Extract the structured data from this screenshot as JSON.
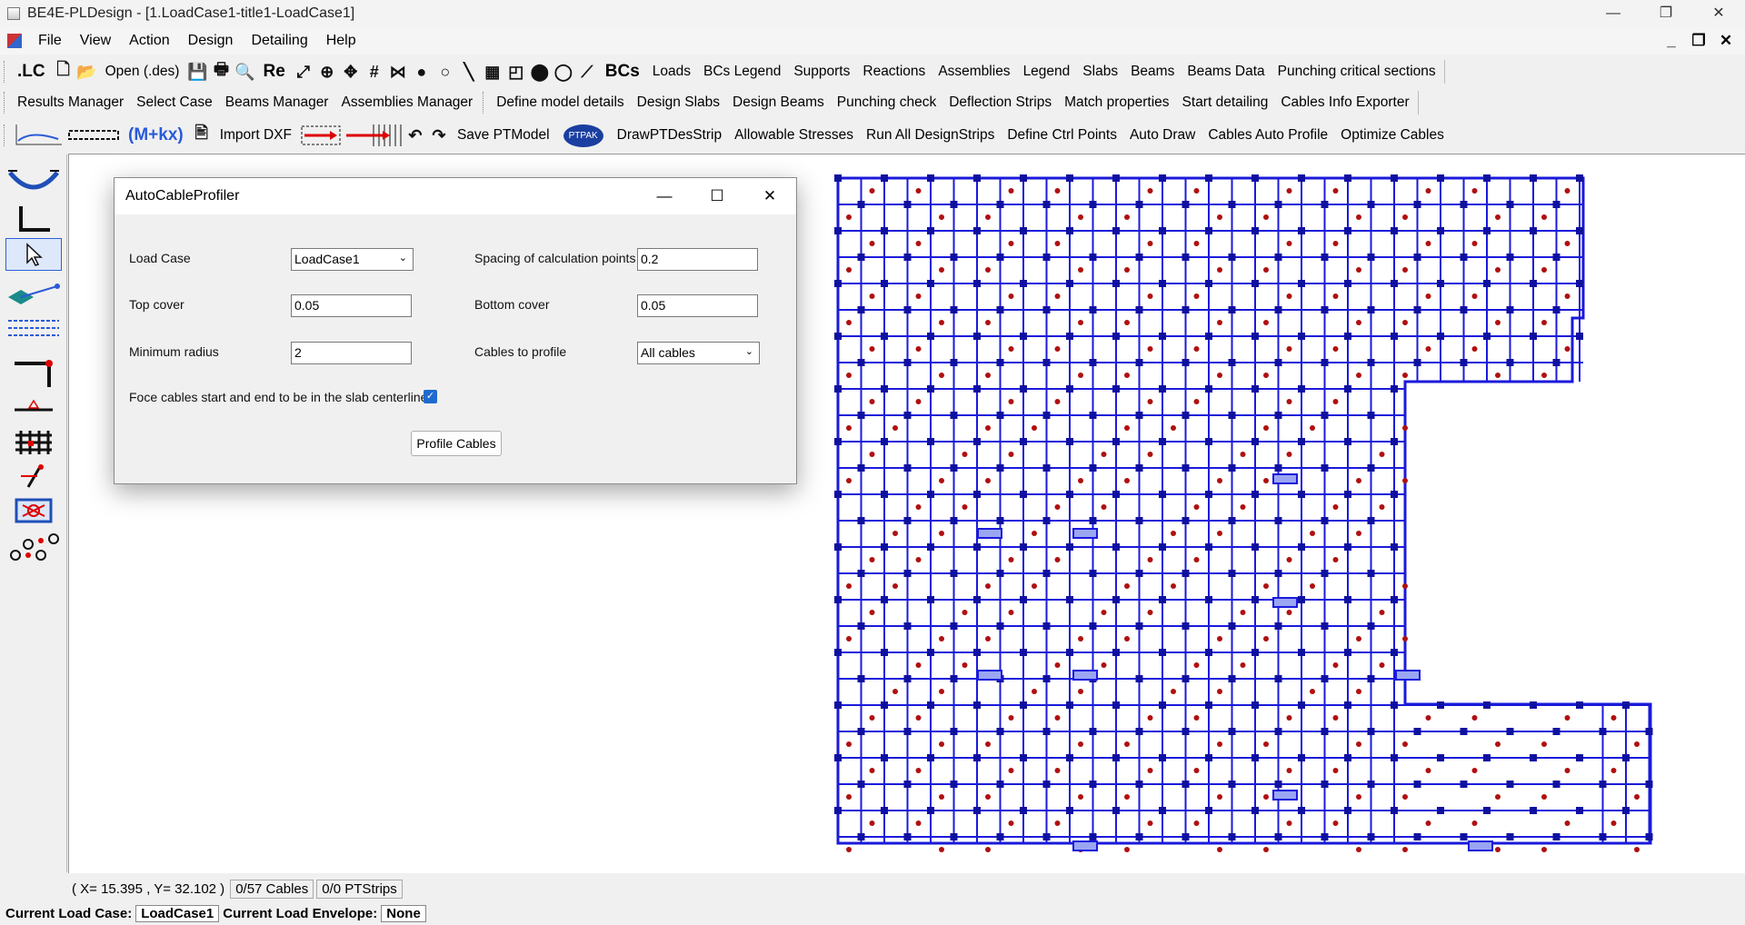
{
  "window": {
    "title": "BE4E-PLDesign - [1.LoadCase1-title1-LoadCase1]",
    "minimize": "—",
    "maximize": "❐",
    "close": "✕"
  },
  "menu": {
    "items": [
      "File",
      "View",
      "Action",
      "Design",
      "Detailing",
      "Help"
    ],
    "mdi_minimize": "_",
    "mdi_restore": "❐",
    "mdi_close": "✕"
  },
  "toolbar1": {
    "lc": ".LC",
    "open": "Open (.des)",
    "re": "Re",
    "bcs": "BCs",
    "items": [
      "Loads",
      "BCs Legend",
      "Supports",
      "Reactions",
      "Assemblies",
      "Legend",
      "Slabs",
      "Beams",
      "Beams Data",
      "Punching critical sections"
    ]
  },
  "toolbar2": {
    "items": [
      "Results Manager",
      "Select Case",
      "Beams Manager",
      "Assemblies Manager",
      "Define model details",
      "Design Slabs",
      "Design Beams",
      "Punching check",
      "Deflection Strips",
      "Match properties",
      "Start detailing",
      "Cables Info Exporter"
    ]
  },
  "toolbar3": {
    "formula": "(M+kx)",
    "import_dxf": "Import DXF",
    "save_pt": "Save PTModel",
    "ptpak": "PTPAK",
    "items": [
      "DrawPTDesStrip",
      "Allowable Stresses",
      "Run All DesignStrips",
      "Define Ctrl Points",
      "Auto Draw",
      "Cables Auto Profile",
      "Optimize Cables"
    ]
  },
  "dialog": {
    "title": "AutoCableProfiler",
    "load_case_label": "Load Case",
    "load_case_value": "LoadCase1",
    "spacing_label": "Spacing of calculation points",
    "spacing_value": "0.2",
    "top_cover_label": "Top cover",
    "top_cover_value": "0.05",
    "bottom_cover_label": "Bottom cover",
    "bottom_cover_value": "0.05",
    "min_radius_label": "Minimum radius",
    "min_radius_value": "2",
    "cables_label": "Cables to profile",
    "cables_value": "All cables",
    "force_label": "Foce cables start and end to be in the slab centerline",
    "force_checked": true,
    "profile_button": "Profile Cables"
  },
  "status": {
    "coords": "( X= 15.395 , Y= 32.102 )",
    "cables": "0/57 Cables",
    "strips": "0/0 PTStrips"
  },
  "bottom": {
    "load_case_label": "Current Load Case:",
    "load_case_value": "LoadCase1",
    "envelope_label": "Current Load Envelope:",
    "envelope_value": "None"
  },
  "colors": {
    "grid": "#1a1adb",
    "support": "#1010a0",
    "node": "#b01010"
  }
}
